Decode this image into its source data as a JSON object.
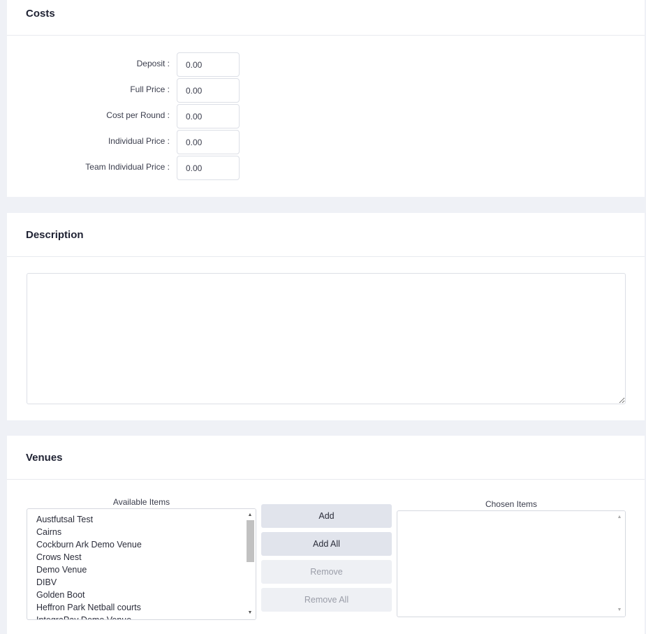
{
  "costs": {
    "title": "Costs",
    "fields": [
      {
        "label": "Deposit :",
        "value": "0.00"
      },
      {
        "label": "Full Price :",
        "value": "0.00"
      },
      {
        "label": "Cost per Round :",
        "value": "0.00"
      },
      {
        "label": "Individual Price :",
        "value": "0.00"
      },
      {
        "label": "Team Individual Price :",
        "value": "0.00"
      }
    ]
  },
  "description": {
    "title": "Description",
    "value": ""
  },
  "venues": {
    "title": "Venues",
    "available_caption": "Available Items",
    "chosen_caption": "Chosen Items",
    "available_items": [
      "Austfutsal Test",
      "Cairns",
      "Cockburn Ark Demo Venue",
      "Crows Nest",
      "Demo Venue",
      "DIBV",
      "Golden Boot",
      "Heffron Park Netball courts",
      "IntegraPay Demo Venue"
    ],
    "chosen_items": [],
    "buttons": {
      "add": "Add",
      "add_all": "Add All",
      "remove": "Remove",
      "remove_all": "Remove All"
    }
  },
  "icons": {
    "scroll_up": "scroll-up-arrow-icon",
    "scroll_down": "scroll-down-arrow-icon"
  }
}
